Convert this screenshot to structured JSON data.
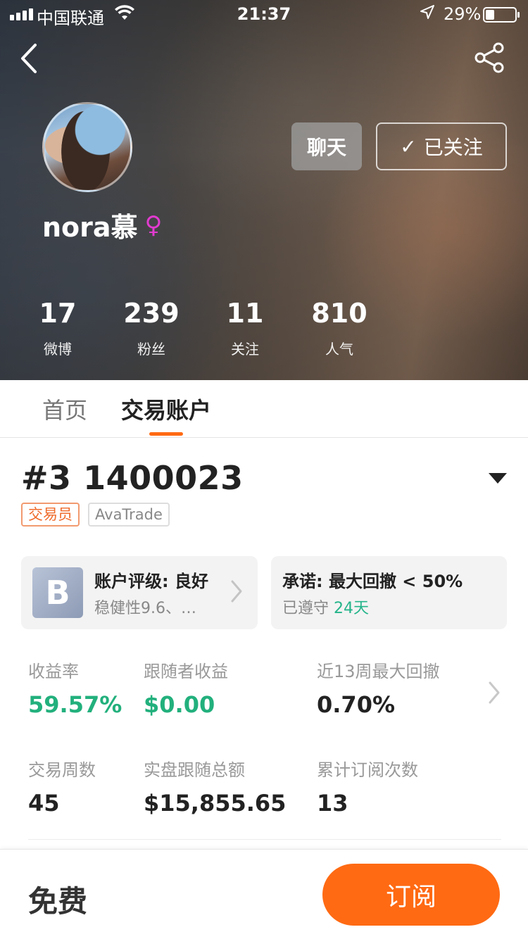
{
  "status_bar": {
    "carrier": "中国联通",
    "time": "21:37",
    "battery_percent": "29%",
    "battery_level": 0.29,
    "icons": [
      "signal-icon",
      "wifi-icon",
      "location-arrow-icon",
      "battery-icon"
    ]
  },
  "header": {
    "back_icon": "chevron-left-icon",
    "share_icon": "share-icon"
  },
  "profile": {
    "username": "nora慕",
    "gender_symbol": "♀",
    "chat_label": "聊天",
    "follow_label": "已关注",
    "follow_check": "✓",
    "stats": [
      {
        "value": "17",
        "label": "微博"
      },
      {
        "value": "239",
        "label": "粉丝"
      },
      {
        "value": "11",
        "label": "关注"
      },
      {
        "value": "810",
        "label": "人气"
      }
    ]
  },
  "tabs": [
    {
      "label": "首页",
      "active": false
    },
    {
      "label": "交易账户",
      "active": true
    }
  ],
  "account": {
    "title": "#3 1400023",
    "tags": [
      "交易员",
      "AvaTrade"
    ],
    "rating_card": {
      "grade": "B",
      "title": "账户评级: 良好",
      "subtitle": "稳健性9.6、…"
    },
    "promise_card": {
      "title": "承诺: 最大回撤 < 50%",
      "kept_label": "已遵守",
      "kept_days": "24天"
    },
    "metrics": [
      {
        "label": "收益率",
        "value": "59.57%"
      },
      {
        "label": "跟随者收益",
        "value": "$0.00"
      },
      {
        "label": "近13周最大回撤",
        "value": "0.70%"
      },
      {
        "label": "交易周数",
        "value": "45"
      },
      {
        "label": "实盘跟随总额",
        "value": "$15,855.65"
      },
      {
        "label": "累计订阅次数",
        "value": "13"
      }
    ]
  },
  "bottom_bar": {
    "price_label": "免费",
    "subscribe_label": "订阅"
  },
  "colors": {
    "accent": "#ff6a13",
    "positive": "#22b07d",
    "tag_role": "#ef6b2b",
    "gender": "#e23bd0"
  }
}
